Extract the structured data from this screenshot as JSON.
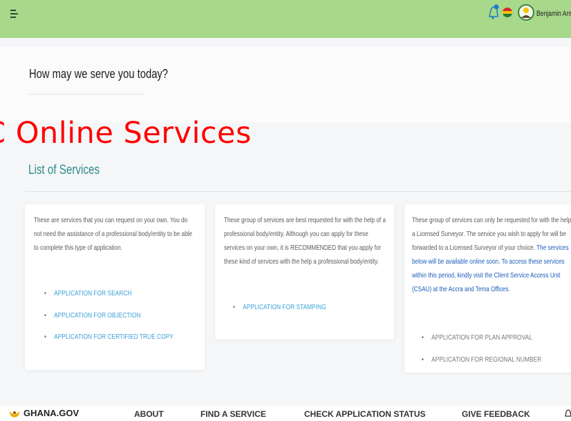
{
  "header": {
    "user_name": "Benjamin Arma",
    "icons": [
      "menu-icon",
      "notification-bell-icon",
      "ghana-flag-icon",
      "user-avatar-icon"
    ],
    "colors": {
      "bar": "#a8d88a"
    }
  },
  "serve": {
    "title": "How may we serve you today?"
  },
  "overlay_title": "C Online Services",
  "list": {
    "title": "List of Services"
  },
  "cards": [
    {
      "description": "These are services that you can request on your own. You do not need the assistance of a professional body/entity to be able to complete this type of application.",
      "services": [
        "APPLICATION FOR SEARCH",
        "APPLICATION FOR OBJECTION",
        "APPLICATION FOR CERTIFIED TRUE COPY"
      ]
    },
    {
      "description": "These group of services are best requested for with the help of a professional body/entity. Although you can apply for these services on your own, it is RECOMMENDED that you apply for these kind of services with the help a professional body/entity.",
      "services": [
        "APPLICATION FOR STAMPING"
      ]
    },
    {
      "description": "These group of services can only be requested for with the help a Licensed Surveyor. The service you wish to apply for will be forwarded to a Licensed Surveyor of your choice.",
      "notice": "The services below will be available online soon. To access these services within this period, kindly visit the Client Service Access Unit (CSAU) at the Accra and Tema Offices.",
      "services": [
        "APPLICATION FOR PLAN APPROVAL",
        "APPLICATION FOR REGIONAL NUMBER"
      ]
    }
  ],
  "footer": {
    "logo": "GHANA.GOV",
    "nav": [
      "ABOUT",
      "FIND A SERVICE",
      "CHECK APPLICATION STATUS",
      "GIVE FEEDBACK"
    ]
  }
}
